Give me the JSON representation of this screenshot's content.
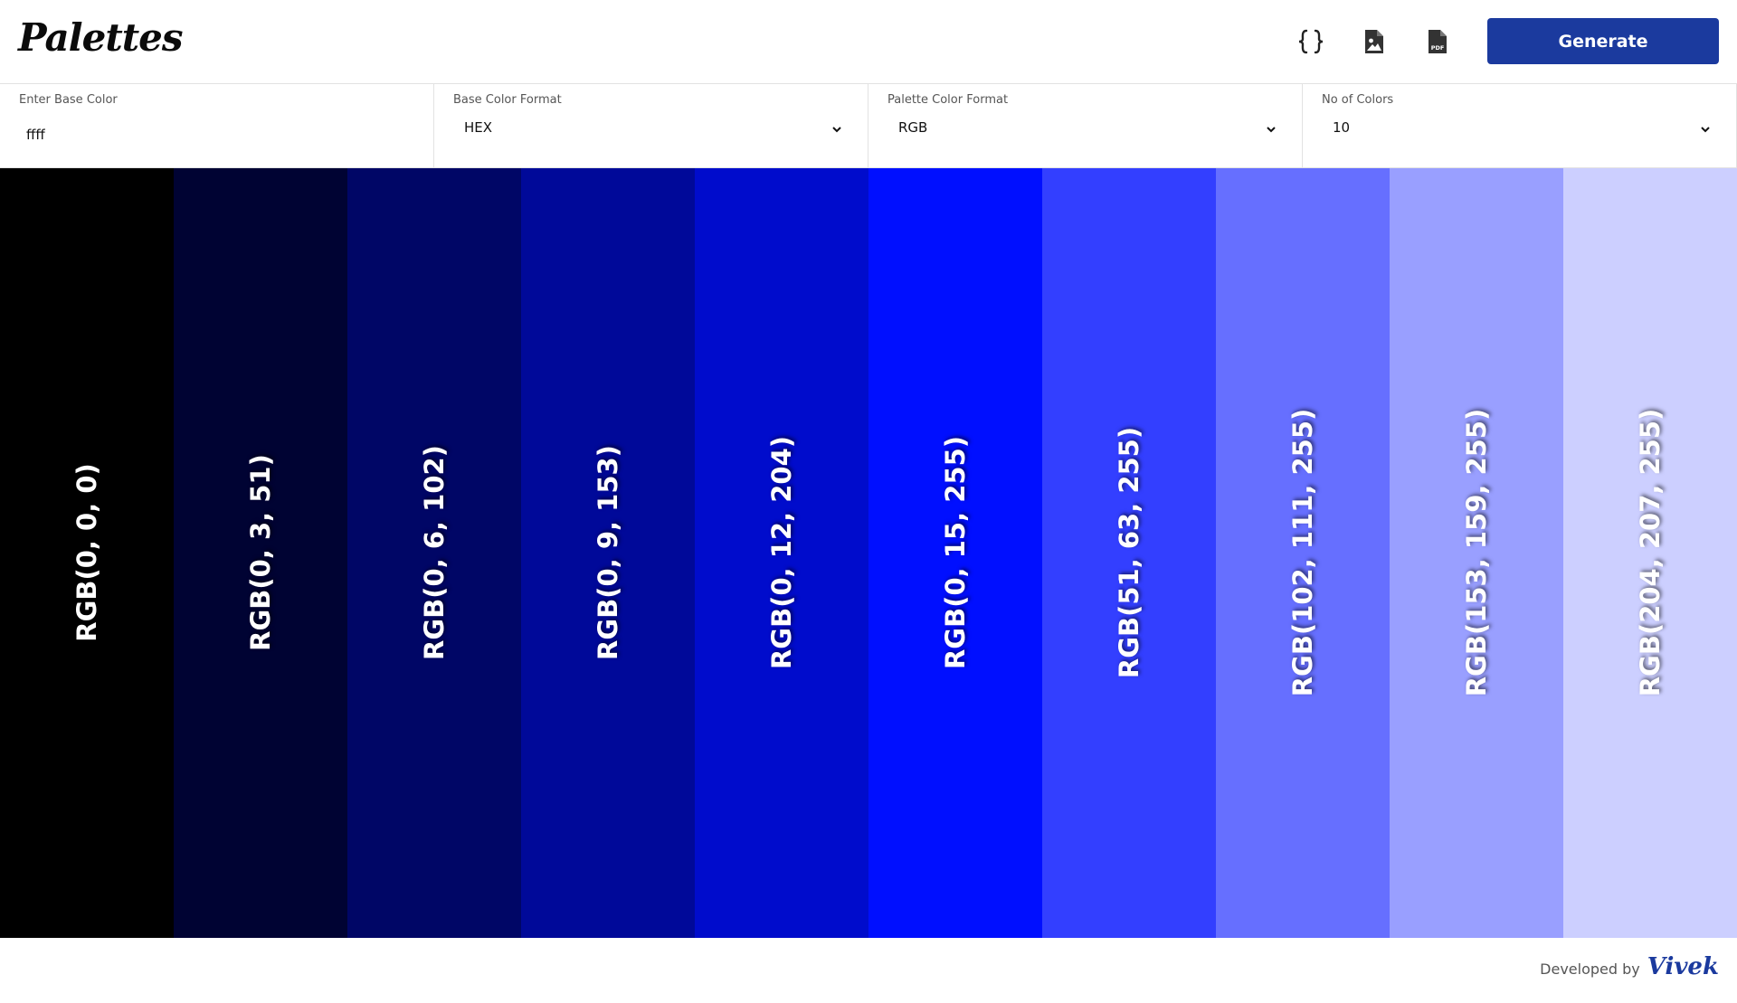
{
  "app": {
    "title": "Palettes"
  },
  "header": {
    "icons": [
      {
        "name": "code-braces-icon",
        "label": "{}"
      },
      {
        "name": "image-file-icon",
        "label": ""
      },
      {
        "name": "pdf-file-icon",
        "label": "PDF"
      }
    ],
    "generate_label": "Generate",
    "accent_color": "#1b3a9e"
  },
  "controls": {
    "base_color": {
      "label": "Enter Base Color",
      "value": "ffff"
    },
    "base_format": {
      "label": "Base Color Format",
      "selected": "HEX"
    },
    "palette_format": {
      "label": "Palette Color Format",
      "selected": "RGB"
    },
    "count": {
      "label": "No of Colors",
      "selected": "10"
    }
  },
  "palette": {
    "swatches": [
      {
        "color": "#000000",
        "label": "RGB(0, 0, 0)"
      },
      {
        "color": "#000333",
        "label": "RGB(0, 3, 51)"
      },
      {
        "color": "#000666",
        "label": "RGB(0, 6, 102)"
      },
      {
        "color": "#000999",
        "label": "RGB(0, 9, 153)"
      },
      {
        "color": "#000ccc",
        "label": "RGB(0, 12, 204)"
      },
      {
        "color": "#000fff",
        "label": "RGB(0, 15, 255)"
      },
      {
        "color": "#333fff",
        "label": "RGB(51, 63, 255)"
      },
      {
        "color": "#666fff",
        "label": "RGB(102, 111, 255)"
      },
      {
        "color": "#999fff",
        "label": "RGB(153, 159, 255)"
      },
      {
        "color": "#cccfff",
        "label": "RGB(204, 207, 255)"
      }
    ]
  },
  "footer": {
    "text": "Developed by",
    "author": "Vivek"
  }
}
